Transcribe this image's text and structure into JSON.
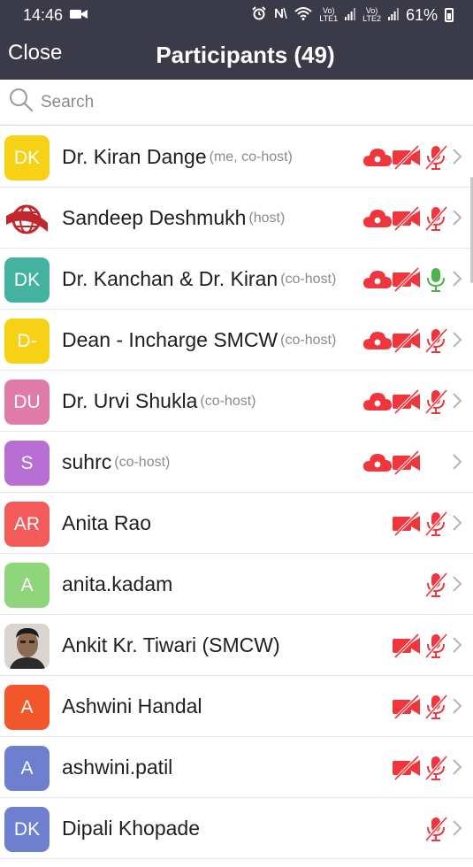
{
  "statusbar": {
    "time": "14:46",
    "volte1": "Vo)",
    "lte1": "LTE1",
    "volte2": "Vo)",
    "lte2": "LTE2",
    "battery": "61%"
  },
  "nav": {
    "close": "Close",
    "title": "Participants (49)"
  },
  "search": {
    "placeholder": "Search"
  },
  "colors": {
    "header": "#3a3a48",
    "muted_red": "#f0353d",
    "mic_on_green": "#4db34d"
  },
  "participants": [
    {
      "initials": "DK",
      "color": "#f7d115",
      "name": "Dr. Kiran Dange",
      "role": "(me, co-host)",
      "cloud": true,
      "video_muted": true,
      "mic": "muted"
    },
    {
      "initials": "",
      "avatar_icon": "globe-logo-icon",
      "name": "Sandeep Deshmukh",
      "role": "(host)",
      "cloud": true,
      "video_muted": true,
      "mic": "muted"
    },
    {
      "initials": "DK",
      "color": "#43b39f",
      "name": "Dr. Kanchan & Dr. Kiran",
      "role": "(co-host)",
      "cloud": true,
      "video_muted": true,
      "mic": "on"
    },
    {
      "initials": "D-",
      "color": "#f7d115",
      "name": "Dean - Incharge SMCW",
      "role": "(co-host)",
      "cloud": true,
      "video_muted": true,
      "mic": "muted"
    },
    {
      "initials": "DU",
      "color": "#e07aa8",
      "name": "Dr. Urvi Shukla",
      "role": "(co-host)",
      "cloud": true,
      "video_muted": true,
      "mic": "muted"
    },
    {
      "initials": "S",
      "color": "#b86fd3",
      "name": "suhrc",
      "role": "(co-host)",
      "cloud": true,
      "video_muted": true,
      "mic": "none"
    },
    {
      "initials": "AR",
      "color": "#f25b59",
      "name": "Anita Rao",
      "role": "",
      "cloud": false,
      "video_muted": true,
      "mic": "muted"
    },
    {
      "initials": "A",
      "color": "#8ed57c",
      "name": "anita.kadam",
      "role": "",
      "cloud": false,
      "video_muted": false,
      "mic": "muted"
    },
    {
      "initials": "",
      "avatar_icon": "profile-photo-icon",
      "name": "Ankit Kr. Tiwari (SMCW)",
      "role": "",
      "cloud": false,
      "video_muted": true,
      "mic": "muted"
    },
    {
      "initials": "A",
      "color": "#f2572c",
      "name": "Ashwini Handal",
      "role": "",
      "cloud": false,
      "video_muted": true,
      "mic": "muted"
    },
    {
      "initials": "A",
      "color": "#6e7fcf",
      "name": "ashwini.patil",
      "role": "",
      "cloud": false,
      "video_muted": true,
      "mic": "muted"
    },
    {
      "initials": "DK",
      "color": "#6e7fcf",
      "name": "Dipali Khopade",
      "role": "",
      "cloud": false,
      "video_muted": false,
      "mic": "muted"
    }
  ]
}
